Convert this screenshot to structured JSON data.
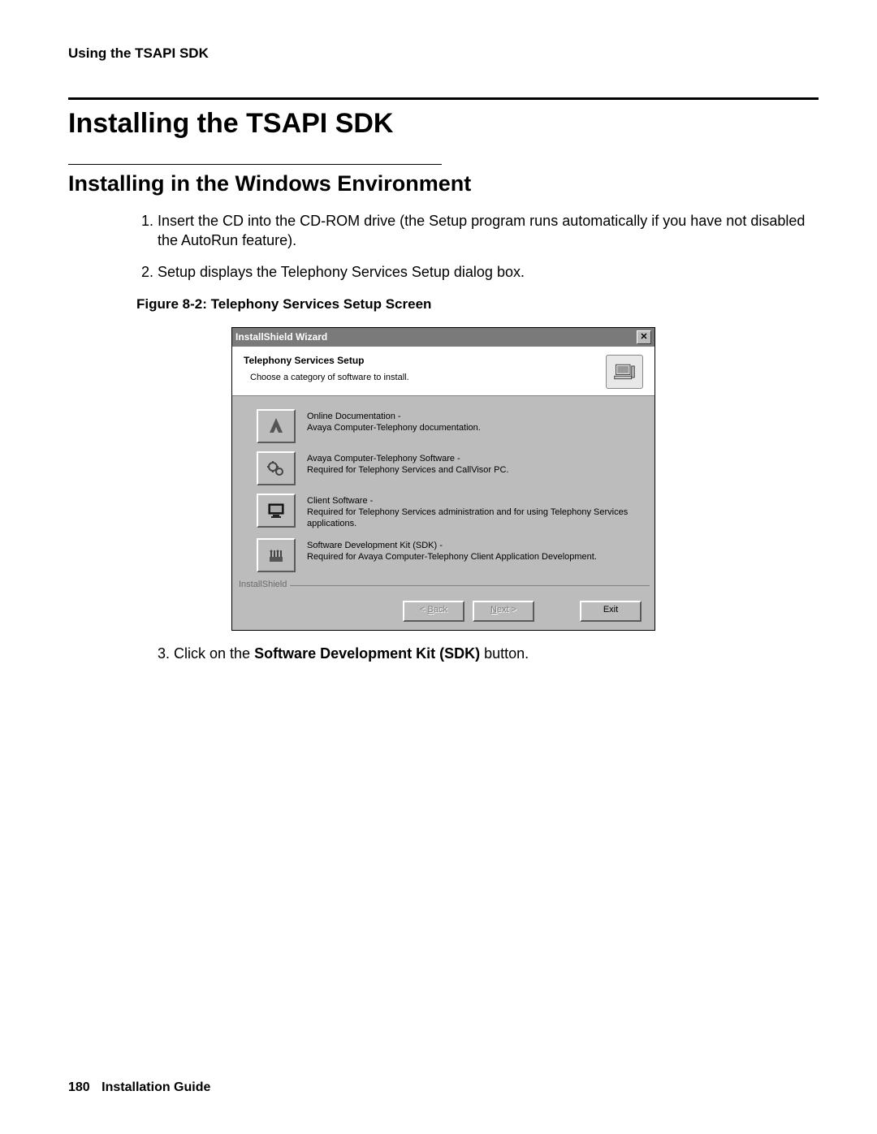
{
  "header": {
    "running": "Using the TSAPI SDK"
  },
  "title": "Installing the TSAPI SDK",
  "subtitle": "Installing in the Windows Environment",
  "steps": {
    "s1": "Insert the CD into the CD-ROM drive (the Setup program runs automatically if you have not disabled the AutoRun feature).",
    "s2": "Setup displays the Telephony Services Setup dialog box."
  },
  "figcap": "Figure 8-2: Telephony Services Setup Screen",
  "step3_pre": "3. Click on the ",
  "step3_bold": "Software Development Kit (SDK)",
  "step3_post": " button.",
  "footer": {
    "page": "180",
    "doc": "Installation Guide"
  },
  "dialog": {
    "titlebar": "InstallShield Wizard",
    "heading": "Telephony Services Setup",
    "sub": "Choose a category of software to install.",
    "options": [
      {
        "t1": "Online Documentation -",
        "t2": "Avaya Computer-Telephony documentation."
      },
      {
        "t1": "Avaya Computer-Telephony Software -",
        "t2": "Required for Telephony Services and CallVisor PC."
      },
      {
        "t1": "Client Software -",
        "t2": "Required for Telephony Services administration and for using Telephony Services applications."
      },
      {
        "t1": "Software Development Kit (SDK) -",
        "t2": "Required for Avaya Computer-Telephony Client Application Development."
      }
    ],
    "group_label": "InstallShield",
    "buttons": {
      "back": "< Back",
      "next": "Next >",
      "exit": "Exit"
    }
  }
}
